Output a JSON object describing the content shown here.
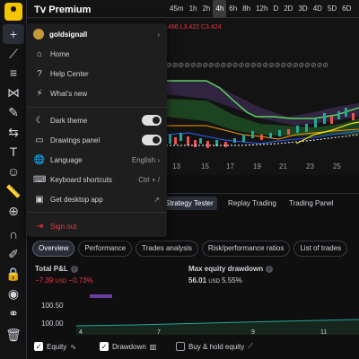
{
  "brand": {
    "premium_label": "Premium"
  },
  "intervals": [
    "45m",
    "1h",
    "2h",
    "4h",
    "6h",
    "8h",
    "12h",
    "D",
    "2D",
    "3D",
    "4D",
    "5D",
    "6D"
  ],
  "active_interval": "4h",
  "chart": {
    "legend": ".486 L3.422 C3.424",
    "x_ticks": [
      "13",
      "15",
      "17",
      "19",
      "21",
      "23",
      "25"
    ]
  },
  "menu": {
    "username": "goldsignall",
    "items": {
      "home": "Home",
      "help_center": "Help Center",
      "whats_new": "What's new",
      "dark_theme": "Dark theme",
      "drawings_panel": "Drawings panel",
      "language": "Language",
      "language_value": "English",
      "keyboard_shortcuts": "Keyboard shortcuts",
      "keyboard_shortcut_hint": "Ctrl + /",
      "get_desktop_app": "Get desktop app",
      "sign_out": "Sign out"
    }
  },
  "bottom_tabs": [
    "Strategy Tester",
    "Replay Trading",
    "Trading Panel"
  ],
  "tester_tabs": [
    "Overview",
    "Performance",
    "Trades analysis",
    "Risk/performance ratios",
    "List of trades"
  ],
  "metrics": {
    "total_pl_label": "Total P&L",
    "total_pl_value": "−7.39",
    "total_pl_unit": "USD",
    "total_pl_pct": "−0.73%",
    "max_dd_label": "Max equity drawdown",
    "max_dd_value": "56.01",
    "max_dd_unit": "USD",
    "max_dd_pct": "5.55%"
  },
  "equity_chart": {
    "y_labels": [
      "100.50",
      "100.00"
    ],
    "x_ticks": [
      "4",
      "7",
      "9",
      "11"
    ]
  },
  "checkboxes": {
    "equity": "Equity",
    "drawdown": "Drawdown",
    "buy_hold": "Buy & hold equity"
  },
  "colors": {
    "accent_red": "#f23645",
    "logo_yellow": "#f5c400",
    "cloud_green": "#2e5e2e",
    "cloud_purple": "#3a2a4e"
  }
}
